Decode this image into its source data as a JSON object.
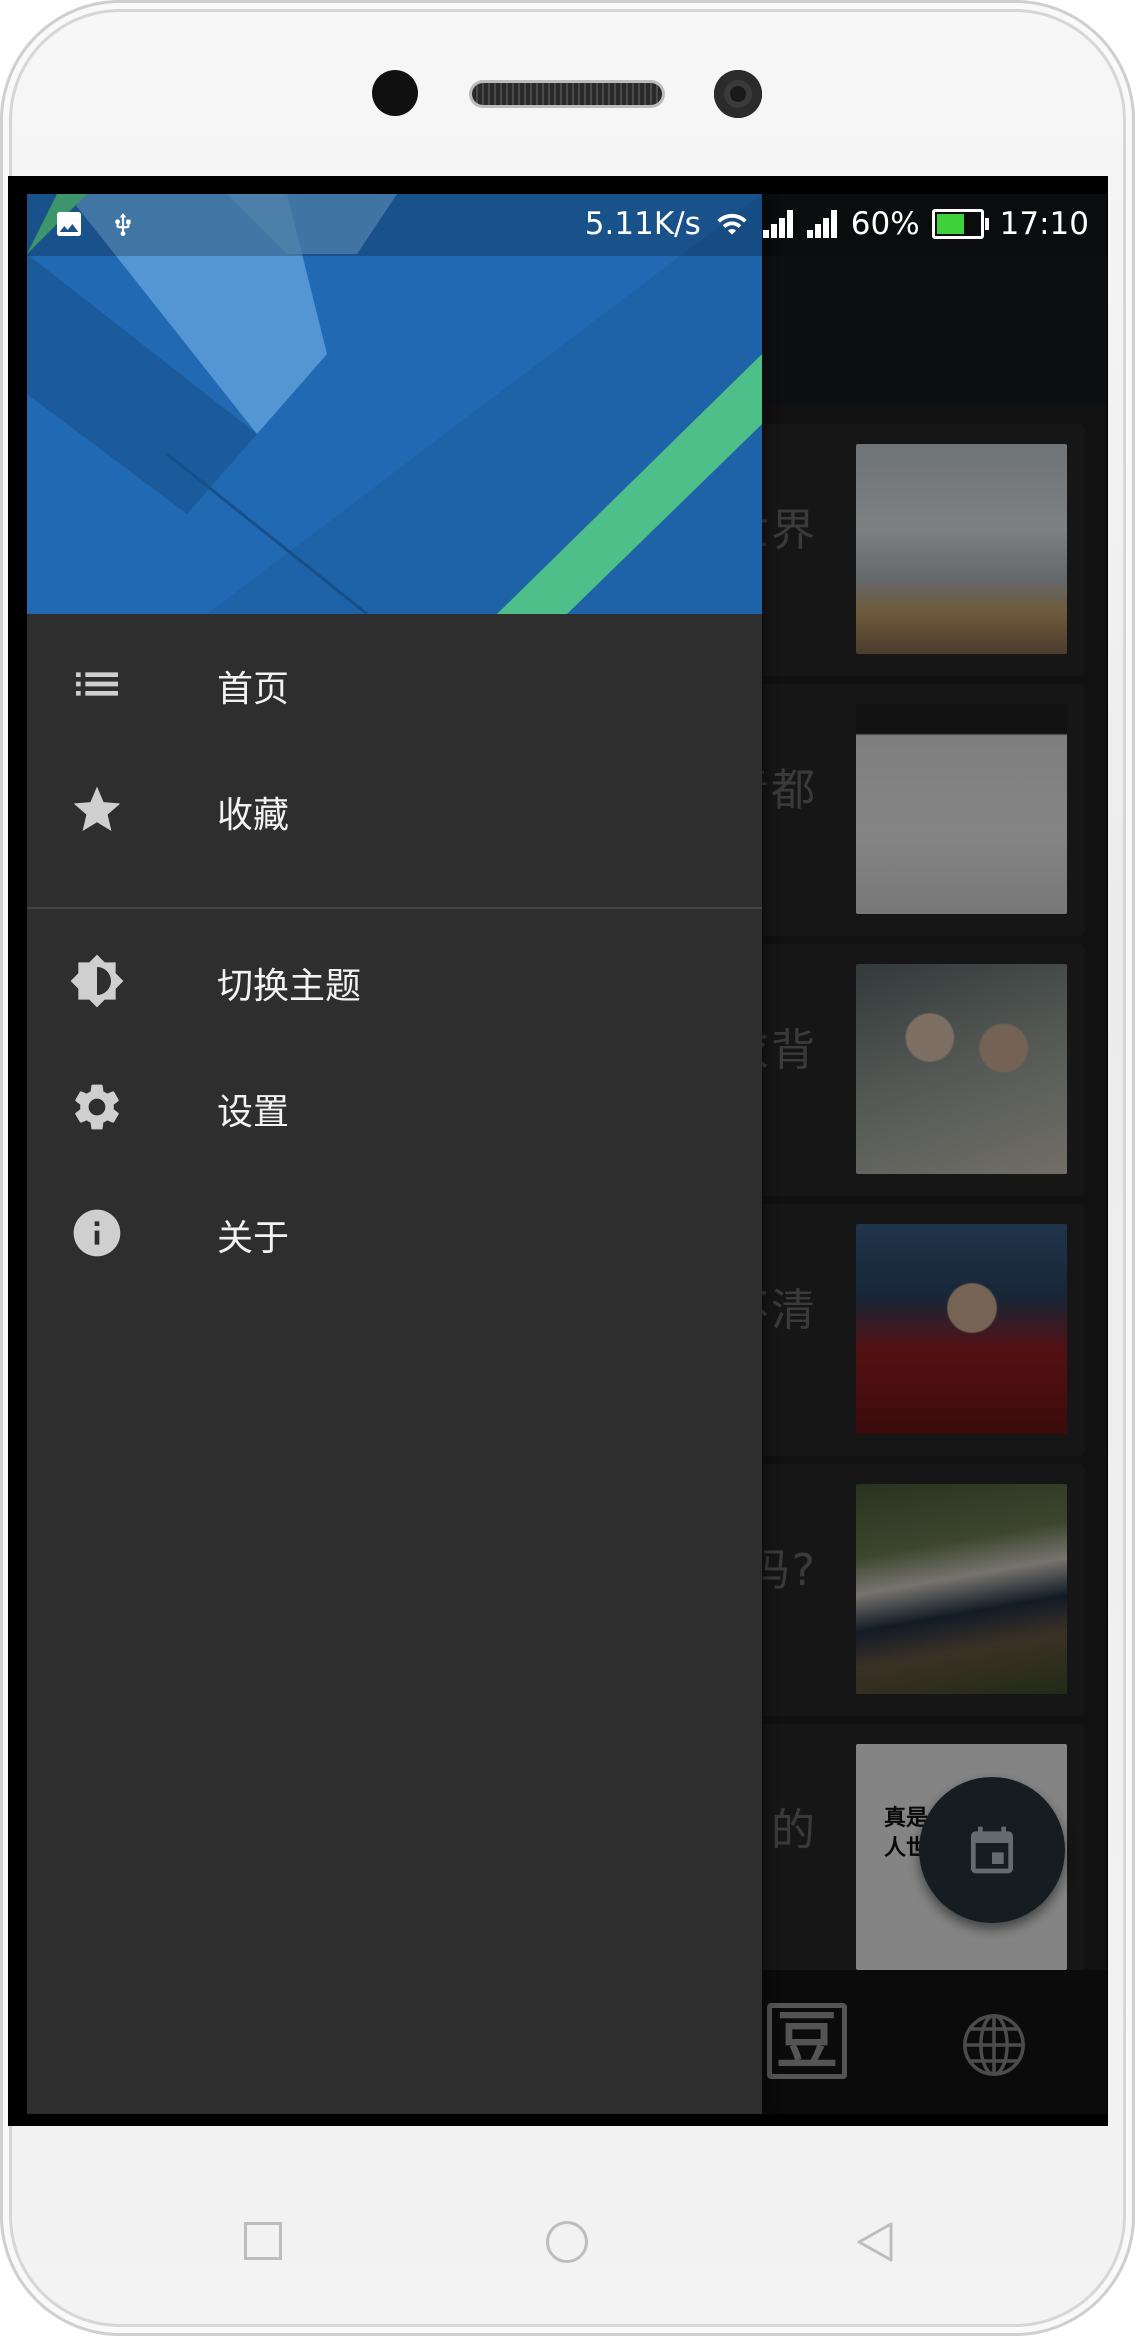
{
  "status_bar": {
    "network_speed": "5.11K/s",
    "battery_percent": "60%",
    "battery_level": 0.6,
    "time": "17:10",
    "icons": [
      "image-icon",
      "usb-icon",
      "wifi-icon",
      "signal-icon",
      "signal-icon",
      "battery-icon"
    ]
  },
  "drawer": {
    "items": [
      {
        "label": "首页",
        "icon": "list-icon"
      },
      {
        "label": "收藏",
        "icon": "star-icon"
      },
      {
        "label": "切换主题",
        "icon": "brightness-icon"
      },
      {
        "label": "设置",
        "icon": "gear-icon"
      },
      {
        "label": "关于",
        "icon": "info-icon"
      }
    ]
  },
  "background_list": {
    "cards": [
      {
        "title_fragment": "世界"
      },
      {
        "title_fragment": "青都"
      },
      {
        "title_fragment": "衣背"
      },
      {
        "title_fragment": "不清"
      },
      {
        "title_fragment": "吗?"
      },
      {
        "title_fragment": "的",
        "thumb_text": "真是\n人世间"
      }
    ]
  },
  "bottom_nav": {
    "items": [
      {
        "label": "豆",
        "icon": "douban-icon"
      },
      {
        "icon": "globe-icon"
      }
    ]
  },
  "fab": {
    "icon": "calendar-icon"
  },
  "colors": {
    "drawer_bg": "#2e2e2e",
    "header_blue": "#1e62a8",
    "header_green": "#4fbf8a",
    "battery_green": "#3ed13c"
  }
}
